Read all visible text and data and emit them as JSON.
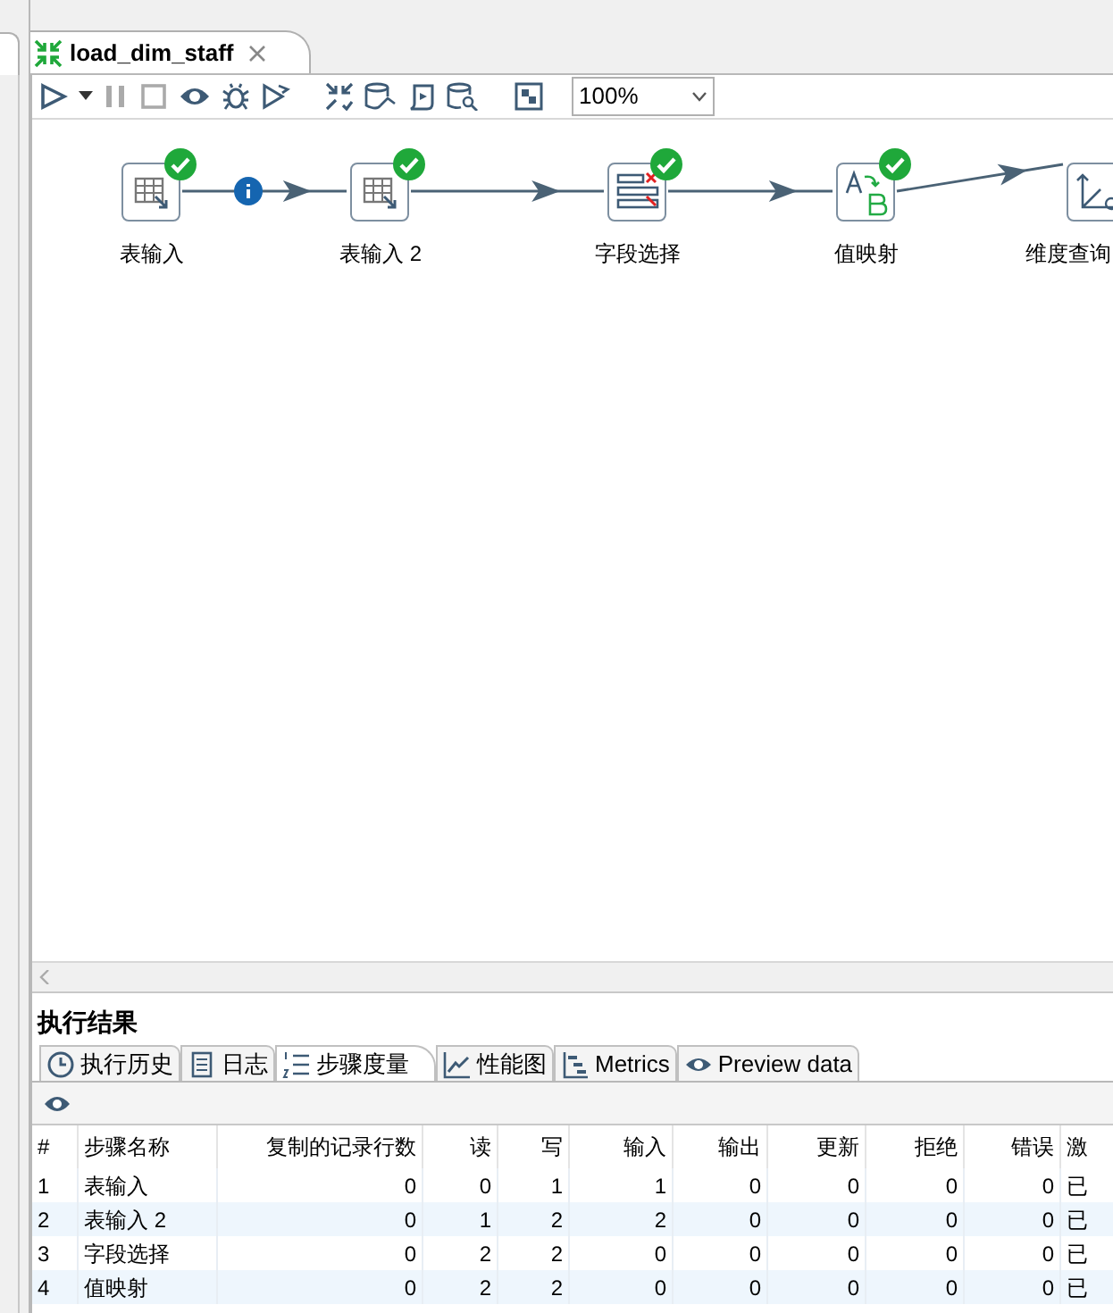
{
  "editor_tab": {
    "title": "load_dim_staff",
    "selected": true
  },
  "toolbar": {
    "zoom": "100%"
  },
  "steps": [
    {
      "label": "表输入",
      "kind": "table-input",
      "ok": true
    },
    {
      "label": "表输入 2",
      "kind": "table-input",
      "ok": true
    },
    {
      "label": "字段选择",
      "kind": "select-values",
      "ok": true
    },
    {
      "label": "值映射",
      "kind": "value-mapper",
      "ok": true
    },
    {
      "label": "维度查询",
      "kind": "dimension-lookup",
      "ok": false
    }
  ],
  "hops": [
    {
      "kind": "info"
    },
    {
      "kind": "plain"
    },
    {
      "kind": "plain"
    },
    {
      "kind": "plain"
    }
  ],
  "results": {
    "title": "执行结果",
    "tabs": [
      {
        "label": "执行历史",
        "kind": "history",
        "selected": false
      },
      {
        "label": "日志",
        "kind": "log",
        "selected": false
      },
      {
        "label": "步骤度量",
        "kind": "steps",
        "selected": true
      },
      {
        "label": "性能图",
        "kind": "chart",
        "selected": false
      },
      {
        "label": "Metrics",
        "kind": "metrics",
        "selected": false
      },
      {
        "label": "Preview data",
        "kind": "preview",
        "selected": false
      }
    ],
    "table": {
      "columns": [
        "#",
        "步骤名称",
        "复制的记录行数",
        "读",
        "写",
        "输入",
        "输出",
        "更新",
        "拒绝",
        "错误",
        "激"
      ],
      "rows": [
        [
          "1",
          "表输入",
          "0",
          "0",
          "1",
          "1",
          "0",
          "0",
          "0",
          "0",
          "已"
        ],
        [
          "2",
          "表输入 2",
          "0",
          "1",
          "2",
          "2",
          "0",
          "0",
          "0",
          "0",
          "已"
        ],
        [
          "3",
          "字段选择",
          "0",
          "2",
          "2",
          "0",
          "0",
          "0",
          "0",
          "0",
          "已"
        ],
        [
          "4",
          "值映射",
          "0",
          "2",
          "2",
          "0",
          "0",
          "0",
          "0",
          "0",
          "已"
        ]
      ]
    }
  }
}
